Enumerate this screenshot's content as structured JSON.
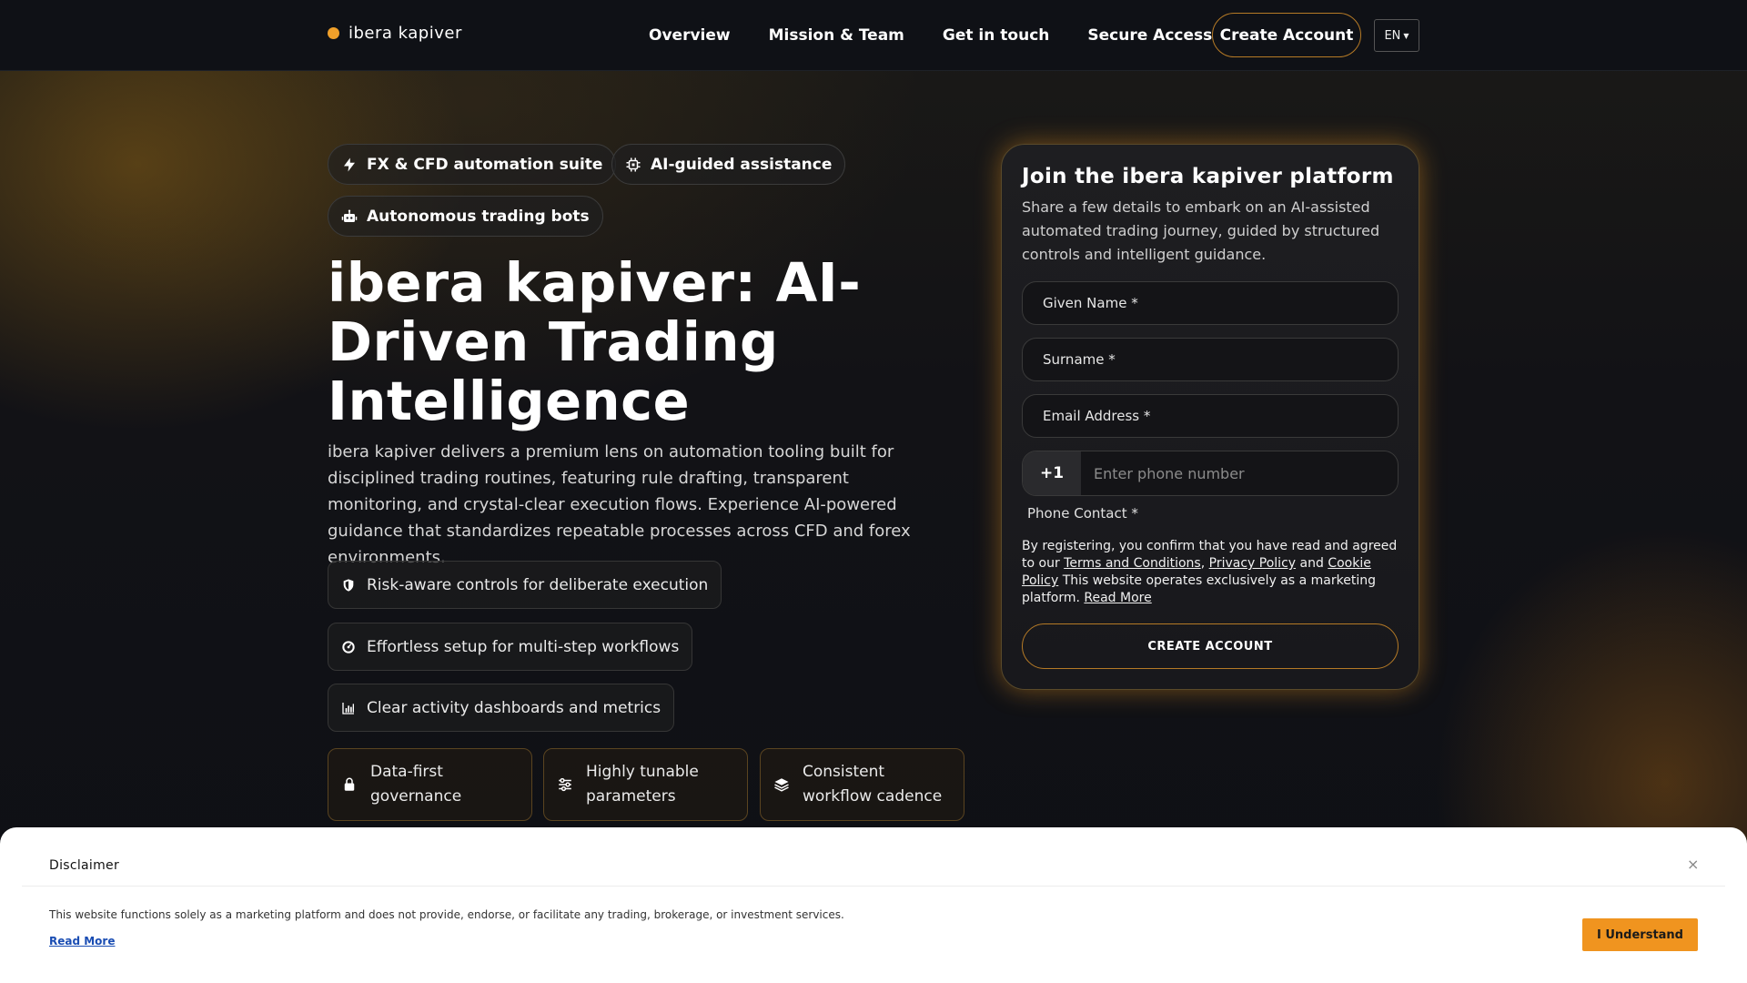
{
  "nav": {
    "brand": "ibera kapiver",
    "links": [
      "Overview",
      "Mission & Team",
      "Get in touch",
      "Secure Access"
    ],
    "cta": "Create Account",
    "language": "EN"
  },
  "hero": {
    "tags": [
      {
        "label": "FX & CFD automation suite",
        "icon": "lightning-icon"
      },
      {
        "label": "AI-guided assistance",
        "icon": "chip-icon"
      },
      {
        "label": "Autonomous trading bots",
        "icon": "robot-icon"
      }
    ],
    "title": "ibera kapiver: AI-Driven Trading Intelligence",
    "lead": "ibera kapiver delivers a premium lens on automation tooling built for disciplined trading routines, featuring rule drafting, transparent monitoring, and crystal-clear execution flows. Experience AI-powered guidance that standardizes repeatable processes across CFD and forex environments.",
    "features": [
      {
        "label": "Risk-aware controls for deliberate execution",
        "icon": "shield-icon"
      },
      {
        "label": "Effortless setup for multi-step workflows",
        "icon": "gauge-icon"
      },
      {
        "label": "Clear activity dashboards and metrics",
        "icon": "bar-chart-icon"
      }
    ],
    "cards": [
      {
        "label": "Data-first governance",
        "icon": "lock-icon"
      },
      {
        "label": "Highly tunable parameters",
        "icon": "sliders-icon"
      },
      {
        "label": "Consistent workflow cadence",
        "icon": "layers-icon"
      }
    ]
  },
  "form": {
    "title": "Join the ibera kapiver platform",
    "subtitle": "Share a few details to embark on an AI-assisted automated trading journey, guided by structured controls and intelligent guidance.",
    "given_name": "Given Name *",
    "surname": "Surname *",
    "email": "Email Address *",
    "phone_prefix": "+1",
    "phone_placeholder": "Enter phone number",
    "phone_label": "Phone Contact *",
    "legal_prefix": "By registering, you confirm that you have read and agreed to our",
    "terms": "Terms and Conditions",
    "comma": ",",
    "privacy": "Privacy Policy",
    "and": "and",
    "cookie": "Cookie Policy",
    "legal_suffix": "This website operates exclusively as a marketing platform.",
    "read_more": "Read More",
    "submit": "CREATE ACCOUNT"
  },
  "disclaimer": {
    "title": "Disclaimer",
    "close": "×",
    "text": "This website functions solely as a marketing platform and does not provide, endorse, or facilitate any trading, brokerage, or investment services.",
    "read_more": "Read More",
    "button": "I Understand"
  },
  "colors": {
    "accent": "#f0941f",
    "background": "#0d0f14",
    "link": "#1a4db3"
  }
}
